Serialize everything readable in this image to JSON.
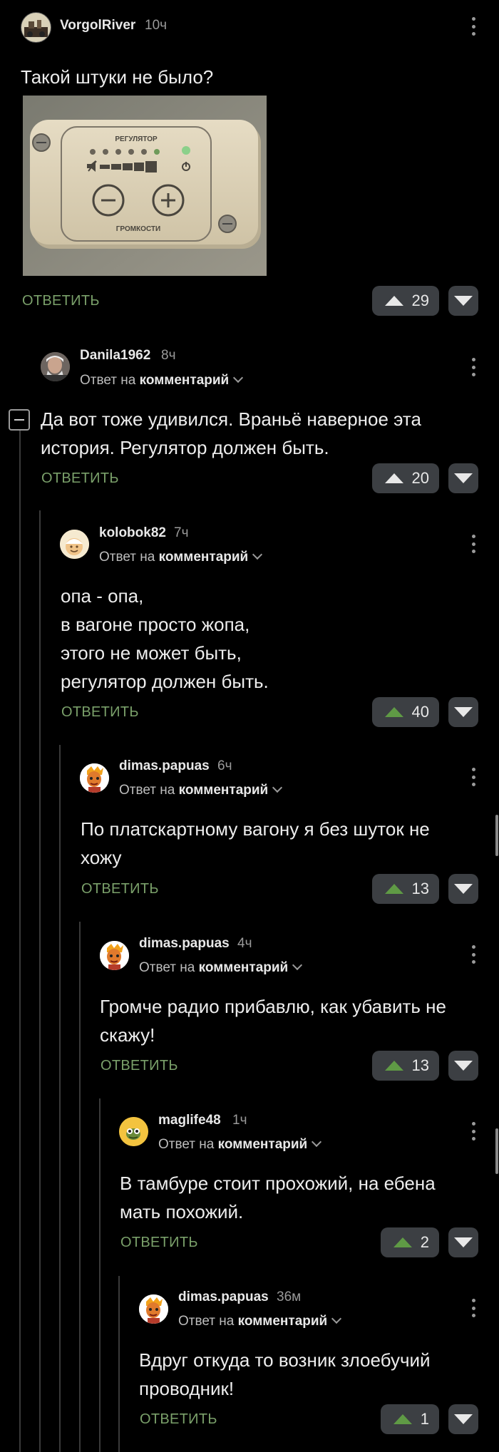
{
  "post": {
    "author": "VorgolRiver",
    "time": "10ч",
    "text": "Такой штуки не было?",
    "image": {
      "title_top": "РЕГУЛЯТОР",
      "title_bottom": "ГРОМКОСТИ"
    },
    "reply_label": "ОТВЕТИТЬ",
    "votes": "29"
  },
  "reply_prefix": "Ответ на",
  "reply_target": "комментарий",
  "comments": [
    {
      "author": "Danila1962",
      "time": "8ч",
      "lines": [
        "Да вот тоже удивился. Враньё наверное эта",
        "история. Регулятор должен быть."
      ],
      "reply_label": "ОТВЕТИТЬ",
      "votes": "20"
    },
    {
      "author": "kolobok82",
      "time": "7ч",
      "lines": [
        "опа - опа,",
        "в вагоне просто жопа,",
        "этого не может быть,",
        "регулятор должен быть."
      ],
      "reply_label": "ОТВЕТИТЬ",
      "votes": "40"
    },
    {
      "author": "dimas.papuas",
      "time": "6ч",
      "lines": [
        "По платскартному вагону я без шуток не",
        "хожу"
      ],
      "reply_label": "ОТВЕТИТЬ",
      "votes": "13"
    },
    {
      "author": "dimas.papuas",
      "time": "4ч",
      "lines": [
        "Громче радио прибавлю, как убавить не",
        "скажу!"
      ],
      "reply_label": "ОТВЕТИТЬ",
      "votes": "13"
    },
    {
      "author": "maglife48",
      "time": "1ч",
      "lines": [
        "В тамбуре стоит прохожий, на ебена",
        "мать похожий."
      ],
      "reply_label": "ОТВЕТИТЬ",
      "votes": "2"
    },
    {
      "author": "dimas.papuas",
      "time": "36м",
      "lines": [
        "Вдруг откуда то возник злоебучий",
        "проводник!"
      ],
      "reply_label": "ОТВЕТИТЬ",
      "votes": "1"
    }
  ],
  "colors": {
    "background": "#000000",
    "accent_green": "#7aa06a",
    "vote_bg": "#3c3f43",
    "thread_line": "#3a3a3a"
  }
}
